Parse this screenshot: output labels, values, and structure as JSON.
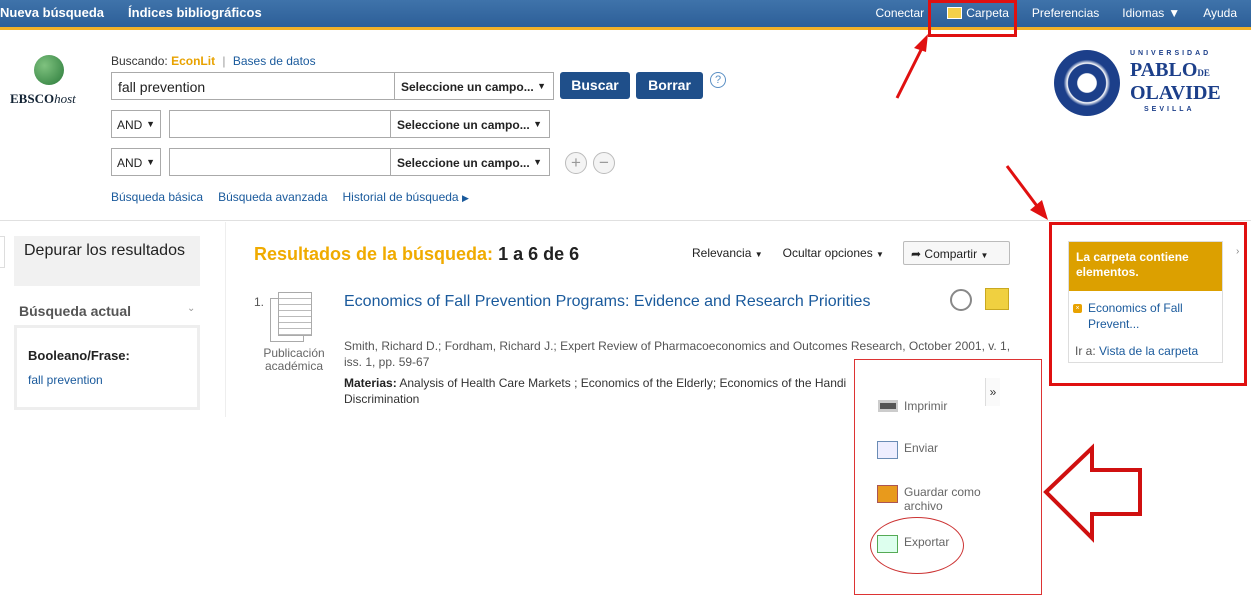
{
  "topbar": {
    "left": [
      "Nueva búsqueda",
      "Índices bibliográficos"
    ],
    "conectar": "Conectar",
    "carpeta": "Carpeta",
    "preferencias": "Preferencias",
    "idiomas": "Idiomas",
    "ayuda": "Ayuda"
  },
  "logo": {
    "brand": "EBSCO",
    "brand_suffix": "host"
  },
  "search": {
    "buscando_label": "Buscando:",
    "database": "EconLit",
    "bases_link": "Bases de datos",
    "query": "fall prevention",
    "field_select": "Seleccione un campo...",
    "field_select_short": "Seleccione un campo...",
    "buscar": "Buscar",
    "borrar": "Borrar",
    "help": "?",
    "bool1": "AND",
    "bool2": "AND",
    "add": "+",
    "remove": "−",
    "links": [
      "Búsqueda básica",
      "Búsqueda avanzada",
      "Historial de búsqueda"
    ]
  },
  "univ": {
    "top": "UNIVERSIDAD",
    "name1": "PABLO",
    "name2": "OLAVIDE",
    "de": "DE",
    "bottom": "SEVILLA"
  },
  "refine": {
    "title": "Depurar los resultados",
    "current": "Búsqueda actual",
    "bool_label": "Booleano/Frase:",
    "bool_value": "fall prevention"
  },
  "results": {
    "label": "Resultados de la búsqueda:",
    "range": "1 a 6 de 6",
    "relevancia": "Relevancia",
    "ocultar": "Ocultar opciones",
    "compartir": "Compartir",
    "items": [
      {
        "num": "1.",
        "type": "Publicación académica",
        "title": "Economics of Fall Prevention Programs: Evidence and Research Priorities",
        "authors": "Smith, Richard D.; Fordham, Richard J.; Expert Review of Pharmacoeconomics and Outcomes Research, October 2001, v. 1, iss. 1, pp. 59-67",
        "materias_label": "Materias:",
        "materias": "Analysis of Health Care Markets ; Economics of the Elderly; Economics of the Handi",
        "materias_cont": "Discrimination"
      }
    ]
  },
  "popup": {
    "chevron": "»",
    "items": [
      "Imprimir",
      "Enviar",
      "Guardar como archivo",
      "Exportar"
    ]
  },
  "carpeta_panel": {
    "header": "La carpeta contiene elementos.",
    "item": "Economics of Fall Prevent...",
    "ira_label": "Ir a:",
    "ira_link": "Vista de la carpeta"
  }
}
